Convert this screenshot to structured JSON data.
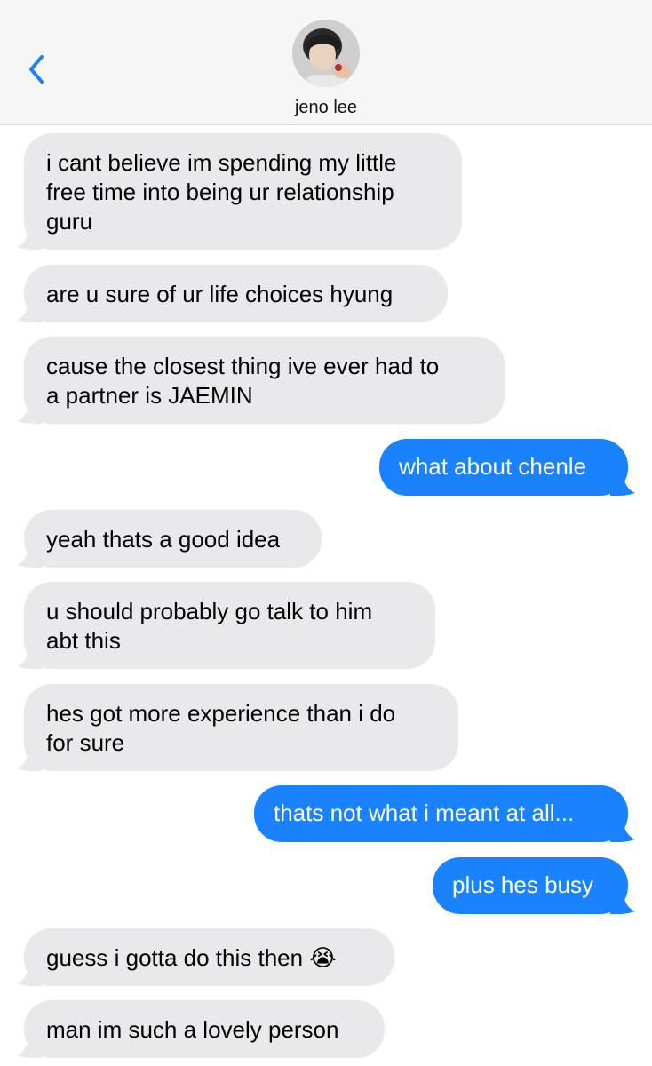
{
  "header": {
    "contact_name": "jeno lee"
  },
  "colors": {
    "incoming_bubble": "#e9e9eb",
    "outgoing_bubble": "#1982fc",
    "accent": "#1982fc"
  },
  "icons": {
    "back": "chevron-left-icon",
    "emoji": "loudly-crying-face"
  },
  "messages": [
    {
      "side": "in",
      "text": "i cant believe im spending my little\nfree time into being ur relationship\nguru"
    },
    {
      "side": "in",
      "text": "are u sure of ur life choices hyung"
    },
    {
      "side": "in",
      "text": "cause the closest thing ive ever had to\na partner is JAEMIN"
    },
    {
      "side": "out",
      "text": "what about chenle"
    },
    {
      "side": "in",
      "text": "yeah thats a good idea"
    },
    {
      "side": "in",
      "text": "u should probably go talk to him\nabt this"
    },
    {
      "side": "in",
      "text": "hes got more experience than i do\nfor sure"
    },
    {
      "side": "out",
      "text": "thats not what i meant at all..."
    },
    {
      "side": "out",
      "text": "plus hes busy"
    },
    {
      "side": "in",
      "text": "guess i gotta do this then 😭"
    },
    {
      "side": "in",
      "text": "man im such a lovely person"
    }
  ]
}
